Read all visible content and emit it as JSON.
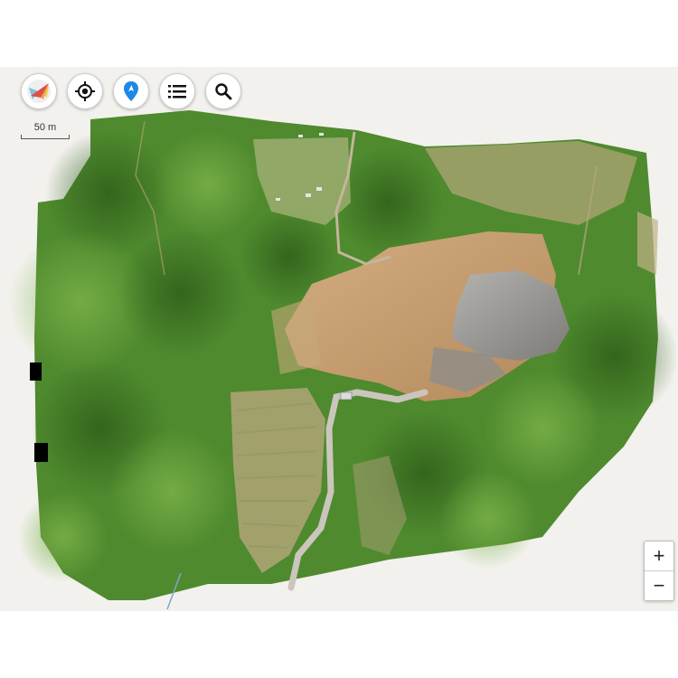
{
  "toolbar": {
    "buttons": [
      {
        "icon": "compass-icon"
      },
      {
        "icon": "locate-icon"
      },
      {
        "icon": "map-pin-icon"
      },
      {
        "icon": "layers-list-icon"
      },
      {
        "icon": "search-icon"
      }
    ]
  },
  "scale": {
    "label": "50 m"
  },
  "zoom": {
    "in_label": "+",
    "out_label": "−"
  },
  "colors": {
    "background": "#f2f1ed",
    "forest": "#4f8a2e",
    "forest_dark": "#3a6f22",
    "bare_soil": "#c9a377",
    "rock": "#9c9a98",
    "road": "#cbc6bd",
    "pin": "#1e88e5"
  }
}
